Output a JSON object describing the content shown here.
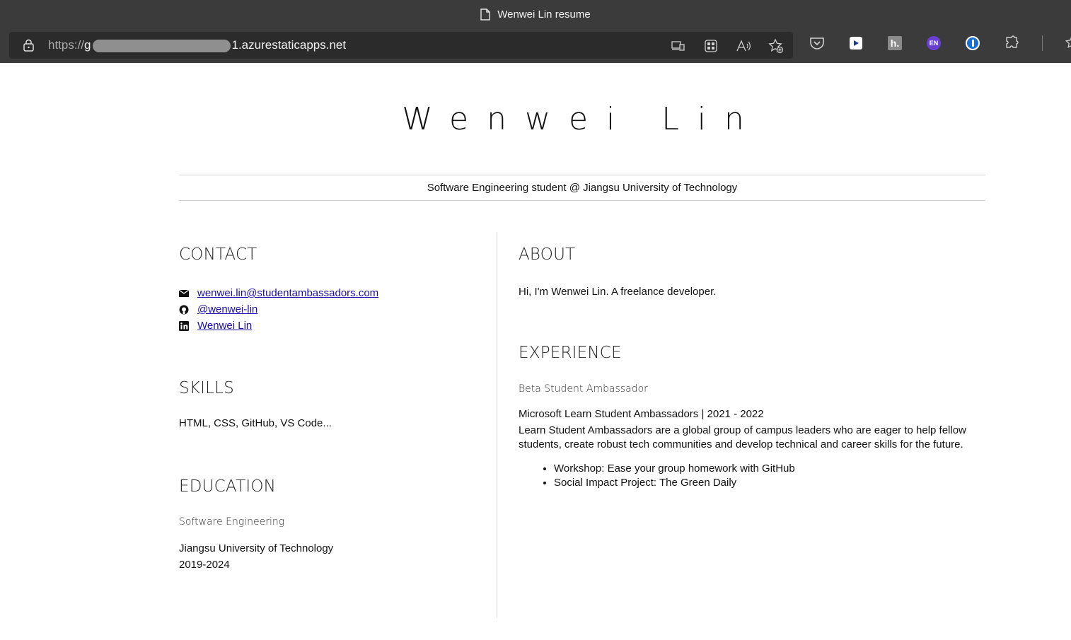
{
  "browser": {
    "tab_title": "Wenwei Lin resume",
    "url_scheme": "https://",
    "url_visible_prefix": "g",
    "url_suffix": "1.azurestaticapps.net",
    "toolbar_icons": [
      "app-available-icon",
      "apps-icon",
      "read-aloud-icon",
      "add-favorite-icon"
    ],
    "extension_icons": [
      "pocket-icon",
      "video-extension-icon",
      "h-extension-icon",
      "en-extension-icon",
      "password-manager-icon",
      "extensions-icon",
      "favorites-icon"
    ],
    "en_badge": "EN",
    "h_badge": "h."
  },
  "resume": {
    "name": "Wenwei Lin",
    "tagline": "Software Engineering student @ Jiangsu University of Technology",
    "contact": {
      "title": "CONTACT",
      "email": "wenwei.lin@studentambassadors.com",
      "github": "@wenwei-lin",
      "linkedin": "Wenwei Lin"
    },
    "skills": {
      "title": "SKILLS",
      "text": "HTML, CSS, GitHub, VS Code..."
    },
    "education": {
      "title": "EDUCATION",
      "degree": "Software Engineering",
      "school": "Jiangsu University of Technology",
      "years": "2019-2024"
    },
    "about": {
      "title": "ABOUT",
      "text": "Hi, I'm Wenwei Lin. A freelance developer."
    },
    "experience": {
      "title": "EXPERIENCE",
      "role": "Beta Student Ambassador",
      "org": "Microsoft Learn Student Ambassadors | 2021 - 2022",
      "description": "Learn Student Ambassadors are a global group of campus leaders who are eager to help fellow students, create robust tech communities and develop technical and career skills for the future.",
      "items": [
        "Workshop: Ease your group homework with GitHub",
        "Social Impact Project: The Green Daily"
      ]
    }
  }
}
